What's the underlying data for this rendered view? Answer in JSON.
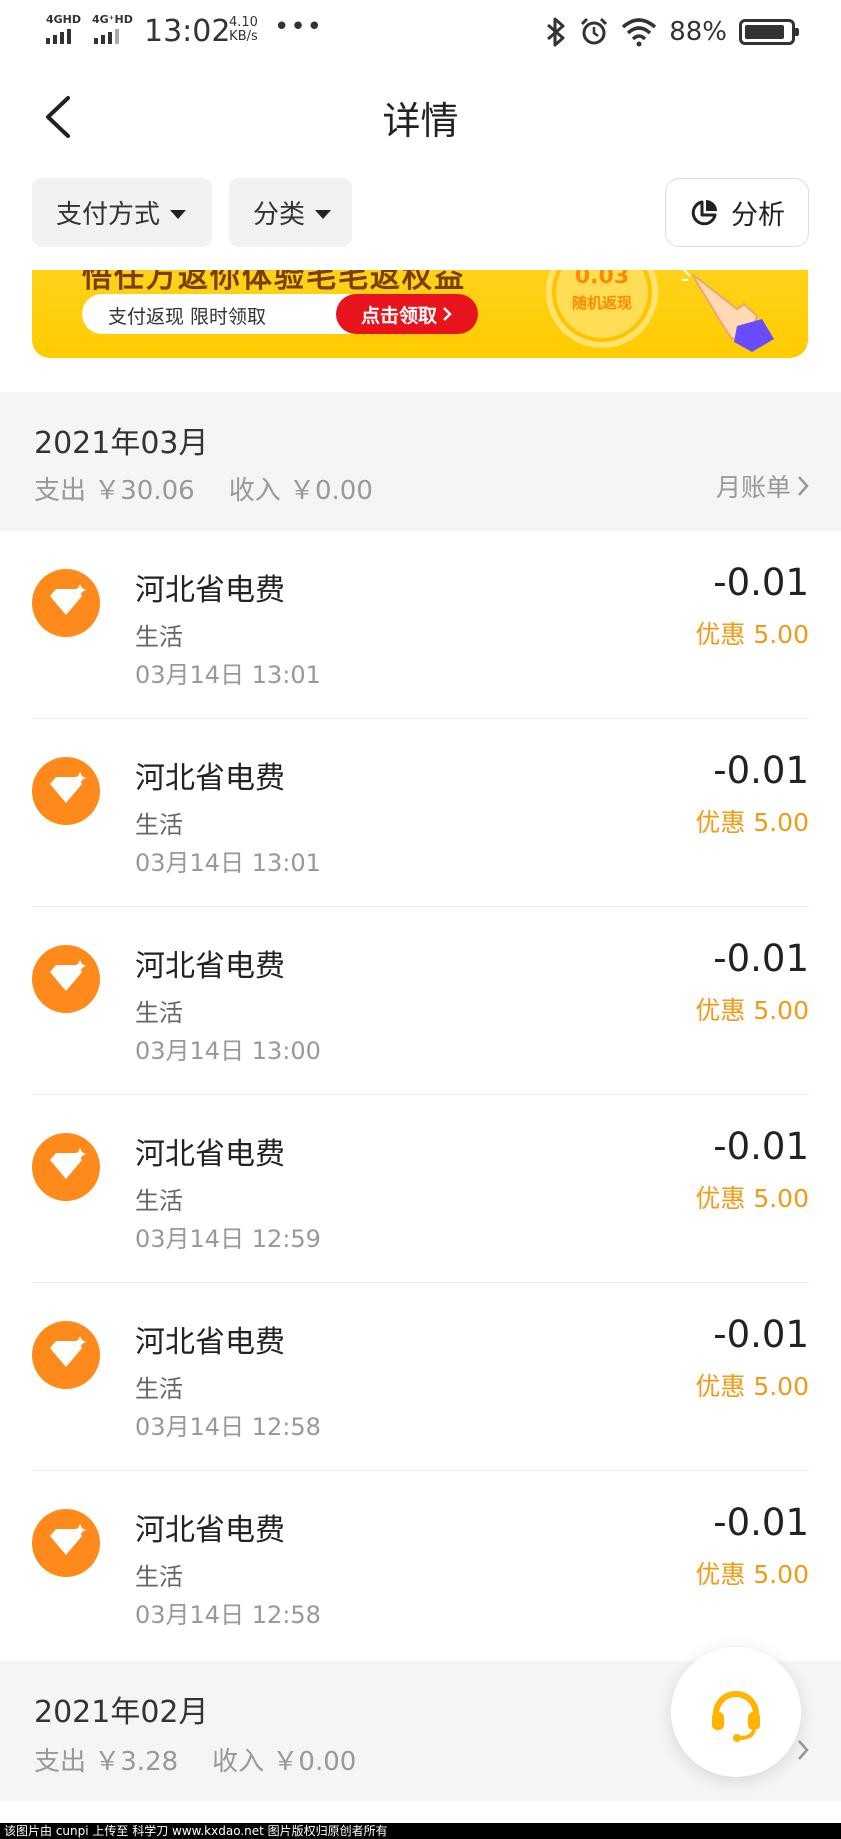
{
  "status_bar": {
    "network_1": "4GHD",
    "network_2": "4G⁺HD",
    "time": "13:02",
    "speed_value": "4.10",
    "speed_unit": "KB/s",
    "more": "•••",
    "battery_pct": "88%",
    "battery_level": 0.88
  },
  "nav": {
    "title": "详情"
  },
  "filters": {
    "payment_method": "支付方式",
    "category": "分类",
    "analysis": "分析"
  },
  "banner": {
    "headline": "悟任万返你体验毛毛返权益",
    "pill_text": "支付返现  限时领取",
    "button": "点击领取",
    "coin_amount": "0.03",
    "coin_label": "随机返现"
  },
  "months": [
    {
      "title": "2021年03月",
      "expense": "支出 ￥30.06",
      "income": "收入 ￥0.00",
      "bill_link": "月账单",
      "transactions": [
        {
          "name": "河北省电费",
          "category": "生活",
          "time": "03月14日 13:01",
          "amount": "-0.01",
          "discount": "优惠 5.00"
        },
        {
          "name": "河北省电费",
          "category": "生活",
          "time": "03月14日 13:01",
          "amount": "-0.01",
          "discount": "优惠 5.00"
        },
        {
          "name": "河北省电费",
          "category": "生活",
          "time": "03月14日 13:00",
          "amount": "-0.01",
          "discount": "优惠 5.00"
        },
        {
          "name": "河北省电费",
          "category": "生活",
          "time": "03月14日 12:59",
          "amount": "-0.01",
          "discount": "优惠 5.00"
        },
        {
          "name": "河北省电费",
          "category": "生活",
          "time": "03月14日 12:58",
          "amount": "-0.01",
          "discount": "优惠 5.00"
        },
        {
          "name": "河北省电费",
          "category": "生活",
          "time": "03月14日 12:58",
          "amount": "-0.01",
          "discount": "优惠 5.00"
        }
      ]
    },
    {
      "title": "2021年02月",
      "expense": "支出 ￥3.28",
      "income": "收入 ￥0.00"
    }
  ],
  "watermark": "该图片由 cunpi 上传至 科学刀 www.kxdao.net 图片版权归原创者所有",
  "colors": {
    "accent_orange": "#ff8a1c",
    "discount_orange": "#ef9b1a",
    "banner_yellow": "#ffcc00",
    "cta_red": "#e8141d",
    "section_gray": "#f5f5f5"
  },
  "icons": {
    "back": "chevron-left-icon",
    "caret": "caret-down-icon",
    "analysis": "pie-chart-icon",
    "transaction": "diamond-icon",
    "service": "headset-icon",
    "bill_chevron": "chevron-right-icon"
  }
}
